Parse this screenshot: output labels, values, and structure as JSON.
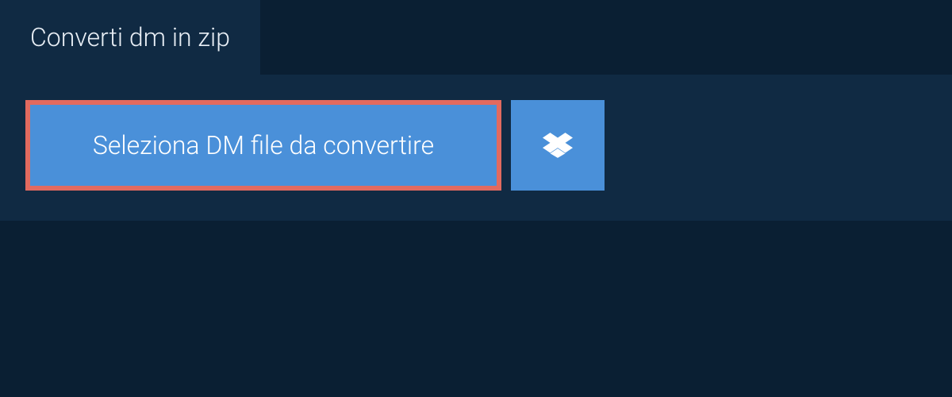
{
  "tab": {
    "label": "Converti dm in zip"
  },
  "actions": {
    "select_file_label": "Seleziona DM file da convertire"
  }
}
